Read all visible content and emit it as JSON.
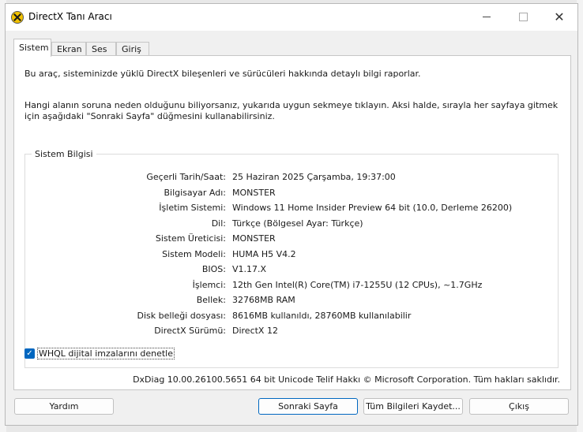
{
  "window": {
    "title": "DirectX Tanı Aracı"
  },
  "tabs": [
    {
      "label": "Sistem",
      "active": true
    },
    {
      "label": "Ekran",
      "active": false
    },
    {
      "label": "Ses",
      "active": false
    },
    {
      "label": "Giriş",
      "active": false
    }
  ],
  "intro": {
    "line1": "Bu araç, sisteminizde yüklü DirectX bileşenleri ve sürücüleri hakkında detaylı bilgi raporlar.",
    "line2": "Hangi alanın soruna neden olduğunu biliyorsanız, yukarıda uygun sekmeye tıklayın. Aksi halde, sırayla her sayfaya gitmek için aşağıdaki \"Sonraki Sayfa\" düğmesini kullanabilirsiniz."
  },
  "system_info": {
    "group_title": "Sistem Bilgisi",
    "rows": [
      {
        "label": "Geçerli Tarih/Saat:",
        "value": "25 Haziran 2025 Çarşamba, 19:37:00"
      },
      {
        "label": "Bilgisayar Adı:",
        "value": "MONSTER"
      },
      {
        "label": "İşletim Sistemi:",
        "value": "Windows 11 Home Insider Preview 64 bit (10.0, Derleme 26200)"
      },
      {
        "label": "Dil:",
        "value": "Türkçe (Bölgesel Ayar: Türkçe)"
      },
      {
        "label": "Sistem Üreticisi:",
        "value": "MONSTER"
      },
      {
        "label": "Sistem Modeli:",
        "value": "HUMA H5 V4.2"
      },
      {
        "label": "BIOS:",
        "value": "V1.17.X"
      },
      {
        "label": "İşlemci:",
        "value": "12th Gen Intel(R) Core(TM) i7-1255U (12 CPUs), ~1.7GHz"
      },
      {
        "label": "Bellek:",
        "value": "32768MB RAM"
      },
      {
        "label": "Disk belleği dosyası:",
        "value": "8616MB kullanıldı, 28760MB kullanılabilir"
      },
      {
        "label": "DirectX Sürümü:",
        "value": "DirectX 12"
      }
    ]
  },
  "whql": {
    "label": "WHQL dijital imzalarını denetle",
    "checked": true
  },
  "footer": {
    "text": "DxDiag 10.00.26100.5651 64 bit Unicode  Telif Hakkı © Microsoft Corporation. Tüm hakları saklıdır."
  },
  "buttons": {
    "help": "Yardım",
    "next": "Sonraki Sayfa",
    "save_all": "Tüm Bilgileri Kaydet...",
    "exit": "Çıkış"
  },
  "icons": {
    "app": "directx-icon",
    "minimize": "minimize-icon",
    "maximize": "maximize-icon",
    "close": "close-icon",
    "check": "checkmark-icon"
  },
  "colors": {
    "accent": "#0067c0"
  }
}
